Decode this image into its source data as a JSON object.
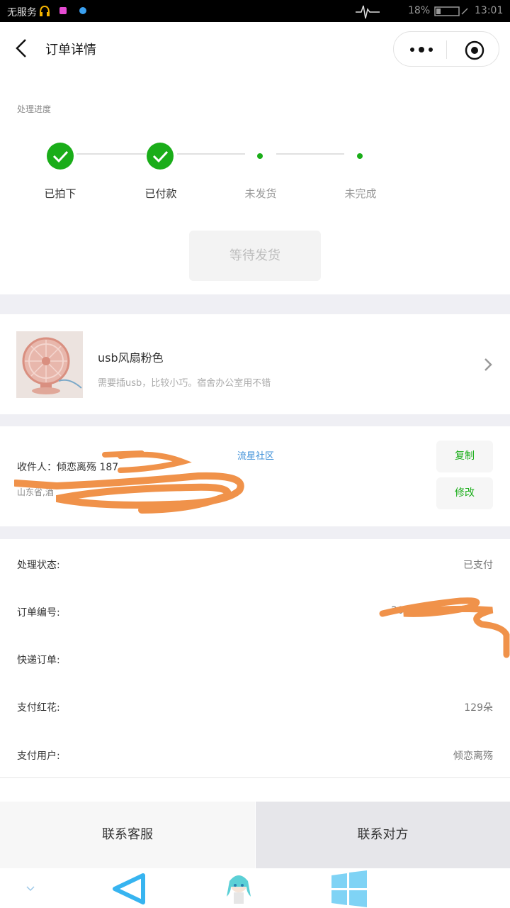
{
  "status_bar": {
    "carrier": "无服务",
    "battery": "18%",
    "time": "13:01"
  },
  "nav": {
    "title": "订单详情"
  },
  "progress": {
    "label": "处理进度",
    "steps": [
      {
        "label": "已拍下",
        "done": true
      },
      {
        "label": "已付款",
        "done": true
      },
      {
        "label": "未发货",
        "done": false
      },
      {
        "label": "未完成",
        "done": false
      }
    ],
    "status_button": "等待发货"
  },
  "product": {
    "name": "usb风扇粉色",
    "desc": "需要插usb，比较小巧。宿舍办公室用不错"
  },
  "address": {
    "receiver": "收件人：倾恋离殇 187",
    "address_line": "山东省,酒",
    "watermark": "流星社区",
    "copy_button": "复制",
    "edit_button": "修改"
  },
  "info": {
    "rows": [
      {
        "label": "处理状态:",
        "value": "已支付"
      },
      {
        "label": "订单编号:",
        "value": "20"
      },
      {
        "label": "快递订单:",
        "value": ""
      },
      {
        "label": "支付红花:",
        "value": "129朵"
      },
      {
        "label": "支付用户:",
        "value": "倾恋离殇"
      }
    ]
  },
  "bottom": {
    "left_button": "联系客服",
    "right_button": "联系对方"
  },
  "colors": {
    "accent_green": "#1aad19",
    "gray_bg": "#efeff4",
    "scribble_orange": "#f0924a"
  }
}
